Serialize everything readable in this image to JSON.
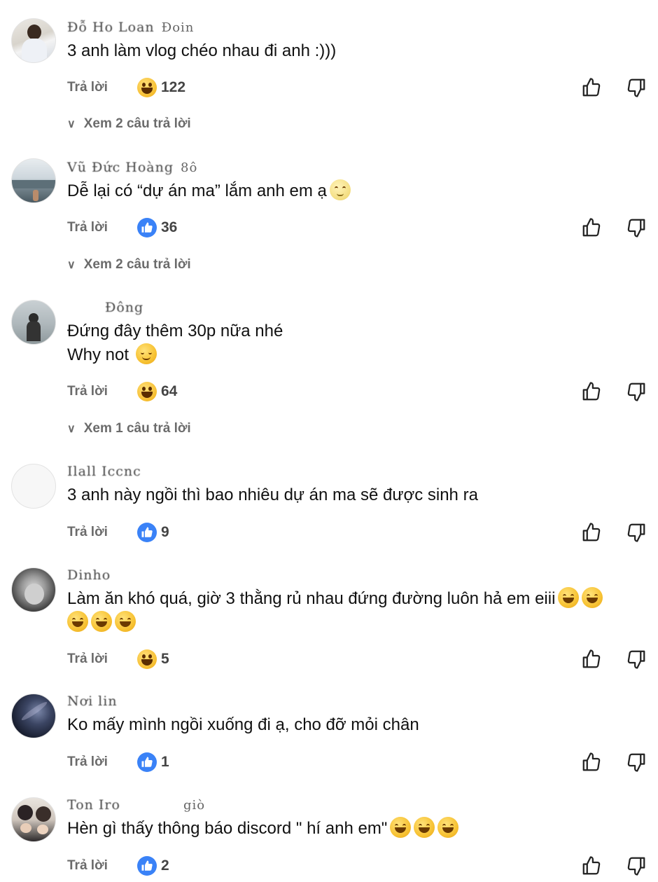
{
  "reply_label": "Trả lời",
  "comments": [
    {
      "name": "Đỗ Ho Loan",
      "time": "Đoin",
      "lines": [
        "3 anh làm vlog chéo nhau đi anh :)))"
      ],
      "reaction": "haha",
      "count": "122",
      "view_replies": "Xem 2 câu trả lời"
    },
    {
      "name": "Vũ Đức Hoàng",
      "time": "8ô",
      "lines": [
        "Dễ lại có “dự án ma” lắm anh em ạ"
      ],
      "reaction": "like",
      "count": "36",
      "view_replies": "Xem 2 câu trả lời"
    },
    {
      "name": "Đông",
      "time": "",
      "lines": [
        "Đứng đây thêm 30p nữa nhé",
        "Why not"
      ],
      "reaction": "haha",
      "count": "64",
      "view_replies": "Xem 1 câu trả lời"
    },
    {
      "name": "Ilall Iccnc",
      "time": "",
      "lines": [
        "3 anh này ngồi thì bao nhiêu dự án ma sẽ được sinh ra"
      ],
      "reaction": "like",
      "count": "9",
      "view_replies": ""
    },
    {
      "name": "Dinho",
      "time": "",
      "lines": [
        "Làm ăn khó quá, giờ 3 thằng rủ nhau đứng đường luôn hả em eiii"
      ],
      "reaction": "haha",
      "count": "5",
      "view_replies": ""
    },
    {
      "name": "Nơi lin",
      "time": "",
      "lines": [
        "Ko mấy mình ngồi xuống đi ạ, cho đỡ mỏi chân"
      ],
      "reaction": "like",
      "count": "1",
      "view_replies": ""
    },
    {
      "name": "Ton Iro",
      "time": "giò",
      "lines": [
        "Hèn gì thấy thông báo discord \" hí anh em\""
      ],
      "reaction": "like",
      "count": "2",
      "view_replies": ""
    }
  ]
}
